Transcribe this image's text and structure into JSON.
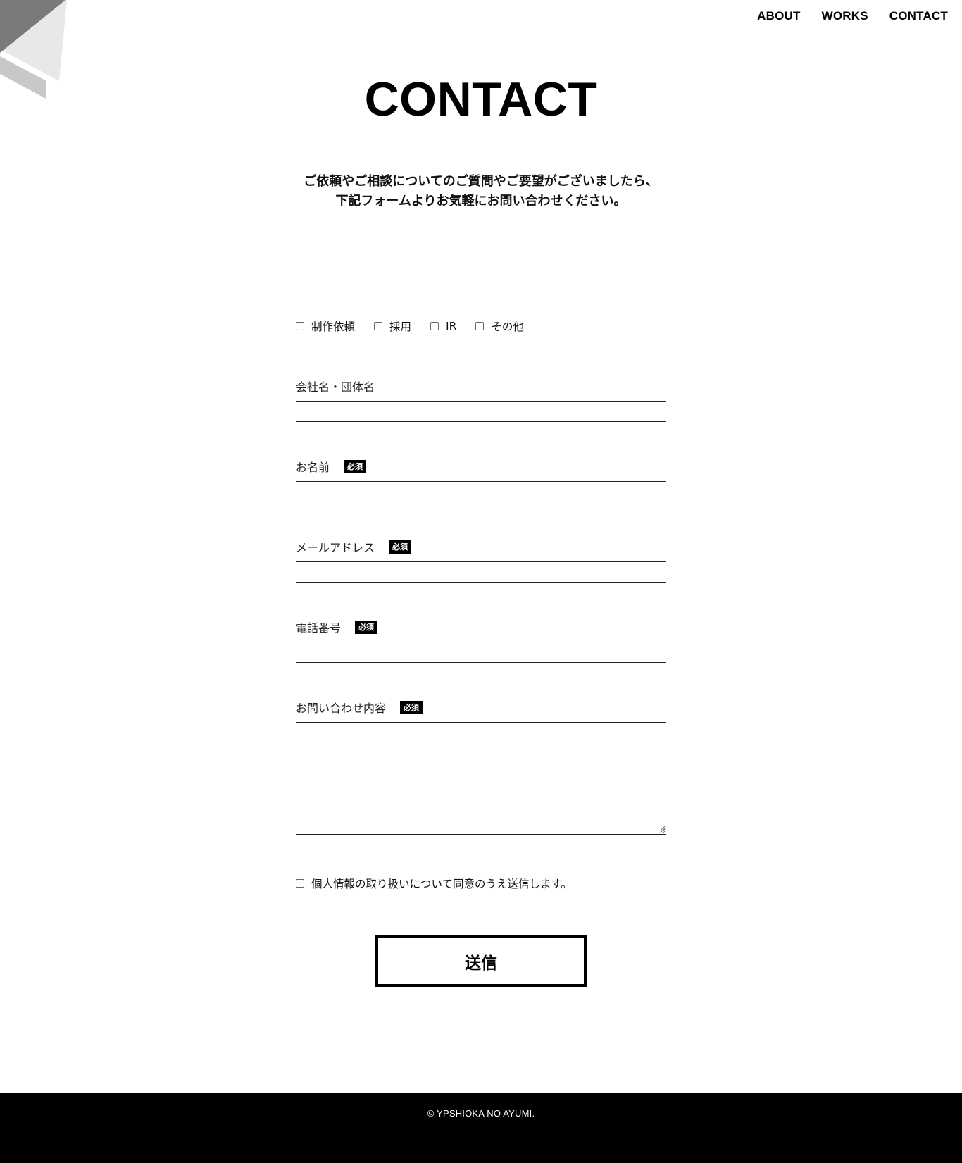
{
  "nav": {
    "items": [
      {
        "label": "ABOUT"
      },
      {
        "label": "WORKS"
      },
      {
        "label": "CONTACT"
      }
    ]
  },
  "page": {
    "title": "CONTACT",
    "intro_line1": "ご依頼やご相談についてのご質問やご要望がございましたら、",
    "intro_line2": "下記フォームよりお気軽にお問い合わせください。"
  },
  "form": {
    "categories": [
      {
        "label": "制作依頼",
        "checked": false
      },
      {
        "label": "採用",
        "checked": false
      },
      {
        "label": "IR",
        "checked": false
      },
      {
        "label": "その他",
        "checked": false
      }
    ],
    "required_badge": "必須",
    "company": {
      "label": "会社名・団体名",
      "value": ""
    },
    "name": {
      "label": "お名前",
      "value": ""
    },
    "email": {
      "label": "メールアドレス",
      "value": ""
    },
    "phone": {
      "label": "電話番号",
      "value": ""
    },
    "message": {
      "label": "お問い合わせ内容",
      "value": ""
    },
    "agree": {
      "label": "個人情報の取り扱いについて同意のうえ送信します。",
      "checked": false
    },
    "submit_label": "送信"
  },
  "footer": {
    "copyright": "© YPSHIOKA NO AYUMI."
  },
  "colors": {
    "background": "#ffffff",
    "text": "#000000",
    "footer_bg": "#000000",
    "deco_dark": "#7a7a7a",
    "deco_light": "#e8e8e8",
    "deco_mid": "#c8c8c8"
  },
  "icons": {
    "corner": "folded-paper-decoration-icon",
    "checkbox": "checkbox-icon",
    "resize": "resize-grip-icon"
  }
}
